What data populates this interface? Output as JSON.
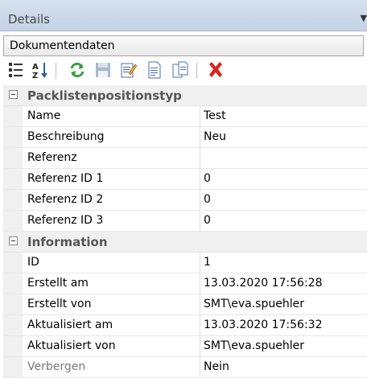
{
  "panel": {
    "title": "Details"
  },
  "object_selector": {
    "value": "Dokumentendaten"
  },
  "toolbar": {
    "icons": [
      "categorized-icon",
      "sort-alphabetical-icon",
      "refresh-icon",
      "save-icon",
      "edit-icon",
      "new-document-icon",
      "copy-document-icon",
      "delete-icon"
    ]
  },
  "grid": {
    "categories": [
      {
        "name": "Packlistenpositionstyp",
        "rows": [
          {
            "name": "Name",
            "value": "Test"
          },
          {
            "name": "Beschreibung",
            "value": "Neu"
          },
          {
            "name": "Referenz",
            "value": ""
          },
          {
            "name": "Referenz ID 1",
            "value": "0"
          },
          {
            "name": "Referenz ID 2",
            "value": "0"
          },
          {
            "name": "Referenz ID 3",
            "value": "0"
          }
        ]
      },
      {
        "name": "Information",
        "rows": [
          {
            "name": "ID",
            "value": "1"
          },
          {
            "name": "Erstellt am",
            "value": "13.03.2020 17:56:28"
          },
          {
            "name": "Erstellt von",
            "value": "SMT\\eva.spuehler"
          },
          {
            "name": "Aktualisiert am",
            "value": "13.03.2020 17:56:32"
          },
          {
            "name": "Aktualisiert von",
            "value": "SMT\\eva.spuehler"
          },
          {
            "name": "Verbergen",
            "value": "Nein"
          }
        ]
      }
    ]
  }
}
